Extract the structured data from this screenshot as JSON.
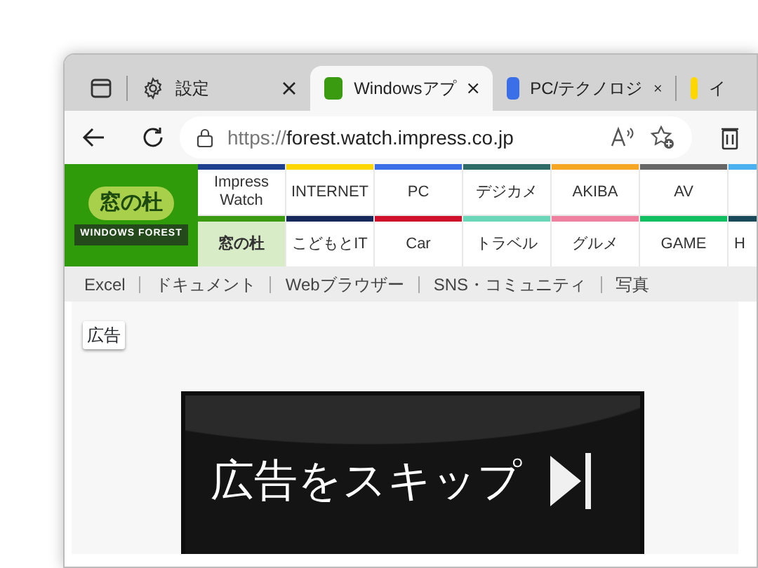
{
  "browser": {
    "tabs": [
      {
        "kind": "settings",
        "label": "設定",
        "selected": false
      },
      {
        "kind": "site",
        "label": "Windowsアプ",
        "color": "#3a9a10",
        "selected": true
      },
      {
        "kind": "site",
        "label": "PC/テクノロジ",
        "color": "#3b6fe8",
        "selected": false
      },
      {
        "kind": "site",
        "label": "イ",
        "color": "#ffd700",
        "selected": false
      }
    ],
    "address": {
      "scheme": "https://",
      "host": "forest.watch.impress.co.jp"
    }
  },
  "site": {
    "logo": {
      "title": "窓の杜",
      "subtitle": "WINDOWS FOREST"
    },
    "nav_rows": [
      [
        {
          "label": "Impress Watch",
          "color": "#1f3f8f",
          "selected": false
        },
        {
          "label": "INTERNET",
          "color": "#ffd700",
          "selected": false
        },
        {
          "label": "PC",
          "color": "#3b6fe8",
          "selected": false
        },
        {
          "label": "デジカメ",
          "color": "#2e6a66",
          "selected": false
        },
        {
          "label": "AKIBA",
          "color": "#f5a623",
          "selected": false
        },
        {
          "label": "AV",
          "color": "#666666",
          "selected": false
        },
        {
          "color": "#4ab0f0",
          "selected": false
        }
      ],
      [
        {
          "label": "窓の杜",
          "color": "#3a9a10",
          "selected": true
        },
        {
          "label": "こどもとIT",
          "color": "#15295a",
          "selected": false
        },
        {
          "label": "Car",
          "color": "#d0102a",
          "selected": false
        },
        {
          "label": "トラベル",
          "color": "#6ad8b8",
          "selected": false
        },
        {
          "label": "グルメ",
          "color": "#f080a0",
          "selected": false
        },
        {
          "label": "GAME",
          "color": "#10c060",
          "selected": false
        },
        {
          "label": "H",
          "color": "#1a4a5a",
          "selected": false
        }
      ]
    ],
    "categories": [
      "Excel",
      "ドキュメント",
      "Webブラウザー",
      "SNS・コミュニティ",
      "写真"
    ],
    "ad": {
      "label": "広告",
      "text": "広告をスキップ"
    }
  }
}
